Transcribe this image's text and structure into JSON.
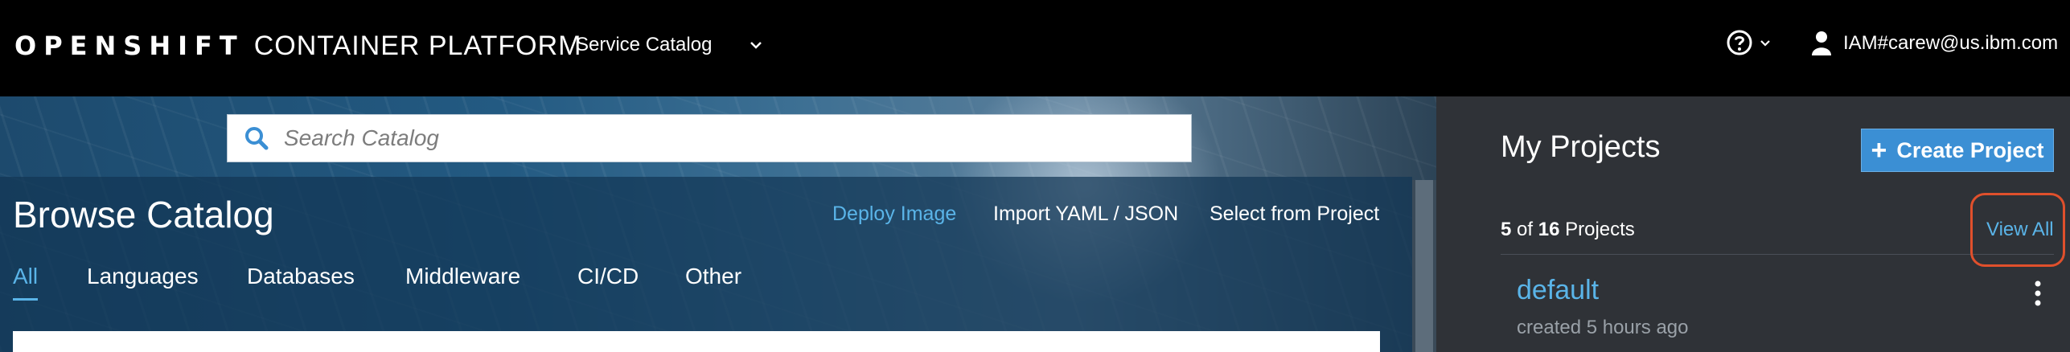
{
  "header": {
    "brand_bold": "OPENSHIFT",
    "brand_rest": "CONTAINER PLATFORM",
    "context_selector": "Service Catalog",
    "user": "IAM#carew@us.ibm.com"
  },
  "search": {
    "placeholder": "Search Catalog"
  },
  "catalog": {
    "title": "Browse Catalog",
    "actions": {
      "deploy_image": "Deploy Image",
      "import_yaml": "Import YAML / JSON",
      "select_from_project": "Select from Project"
    },
    "tabs": [
      "All",
      "Languages",
      "Databases",
      "Middleware",
      "CI/CD",
      "Other"
    ],
    "active_tab": "All"
  },
  "projects_panel": {
    "title": "My Projects",
    "create_button": "Create Project",
    "count_shown": "5",
    "count_of": "of",
    "count_total": "16",
    "count_label": "Projects",
    "view_all": "View All",
    "items": [
      {
        "name": "default",
        "created": "created 5 hours ago"
      }
    ]
  },
  "colors": {
    "accent": "#5ab4e8",
    "button": "#3b8fd4",
    "highlight": "#e0502c",
    "sidebar_bg": "#2f3237"
  }
}
